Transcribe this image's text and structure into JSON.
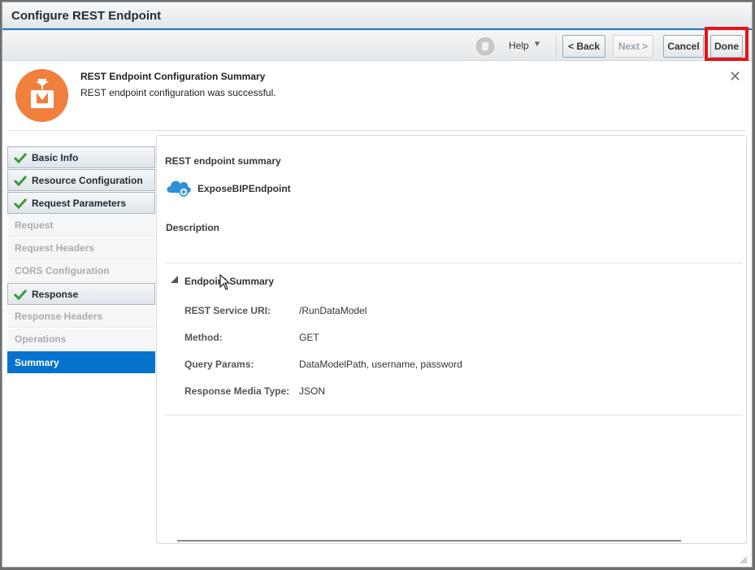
{
  "window": {
    "title": "Configure REST Endpoint"
  },
  "toolbar": {
    "help_label": "Help",
    "back_label": "< Back",
    "next_label": "Next >",
    "cancel_label": "Cancel",
    "done_label": "Done"
  },
  "banner": {
    "title": "REST Endpoint Configuration Summary",
    "message": "REST endpoint configuration was successful.",
    "close": "✕"
  },
  "nav": {
    "items": [
      {
        "label": "Basic Info",
        "state": "done"
      },
      {
        "label": "Resource Configuration",
        "state": "done"
      },
      {
        "label": "Request Parameters",
        "state": "done"
      },
      {
        "label": "Request",
        "state": "disabled"
      },
      {
        "label": "Request Headers",
        "state": "disabled"
      },
      {
        "label": "CORS Configuration",
        "state": "disabled"
      },
      {
        "label": "Response",
        "state": "done"
      },
      {
        "label": "Response Headers",
        "state": "disabled"
      },
      {
        "label": "Operations",
        "state": "disabled"
      },
      {
        "label": "Summary",
        "state": "active"
      }
    ]
  },
  "summary": {
    "section_title": "REST endpoint summary",
    "endpoint_name": "ExposeBIPEndpoint",
    "description_label": "Description",
    "endpoint_summary_title": "Endpoint Summary",
    "rows": [
      {
        "label": "REST Service URI:",
        "value": "/RunDataModel"
      },
      {
        "label": "Method:",
        "value": "GET"
      },
      {
        "label": "Query Params:",
        "value": "DataModelPath, username, password"
      },
      {
        "label": "Response Media Type:",
        "value": "JSON"
      }
    ]
  },
  "colors": {
    "accent": "#0572ce",
    "success_icon": "#f0803c",
    "check": "#3c9a3c",
    "highlight": "#e4141b"
  }
}
